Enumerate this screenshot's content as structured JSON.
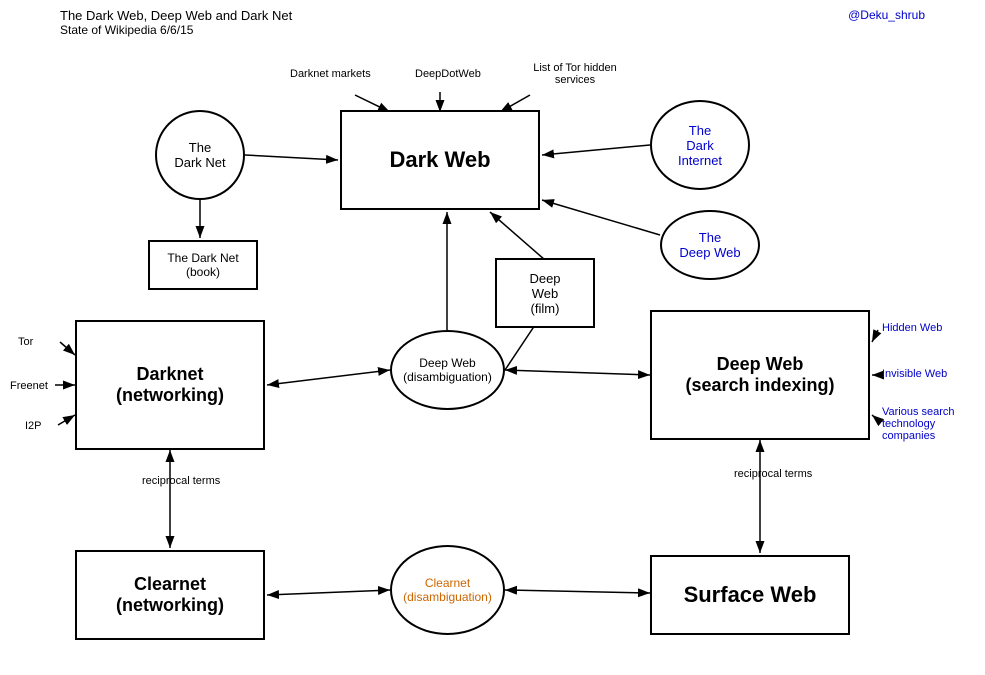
{
  "title": {
    "main": "The Dark Web, Deep Web and Dark Net",
    "sub": "State of Wikipedia 6/6/15",
    "credit": "@Deku_shrub"
  },
  "nodes": {
    "dark_web": "Dark Web",
    "dark_net_circle": "The\nDark Net",
    "dark_internet": "The\nDark\nInternet",
    "deep_web_right": "The\nDeep Web",
    "dark_net_book": "The Dark Net\n(book)",
    "deep_web_film": "Deep\nWeb\n(film)",
    "deep_web_disambig": "Deep Web\n(disambiguation)",
    "darknet_networking": "Darknet\n(networking)",
    "deep_web_search": "Deep Web\n(search indexing)",
    "clearnet_networking": "Clearnet\n(networking)",
    "clearnet_disambig": "Clearnet\n(disambiguation)",
    "surface_web": "Surface Web"
  },
  "labels": {
    "darknet_markets": "Darknet markets",
    "deepdotweb": "DeepDotWeb",
    "list_tor": "List of Tor\nhidden services",
    "reciprocal_left": "reciprocal\nterms",
    "reciprocal_right": "reciprocal\nterms",
    "tor": "Tor",
    "freenet": "Freenet",
    "i2p": "I2P",
    "hidden_web": "Hidden Web",
    "invisible_web": "Invisible Web",
    "various_search": "Various search\ntechnology\ncompanies"
  }
}
